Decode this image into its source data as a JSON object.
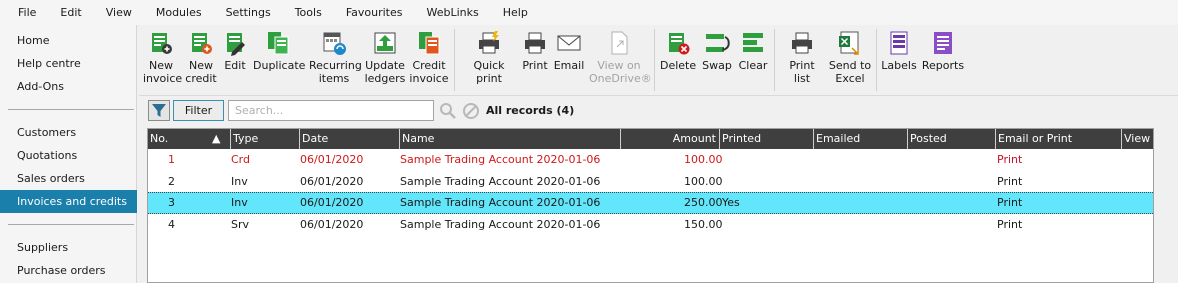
{
  "menu": [
    "File",
    "Edit",
    "View",
    "Modules",
    "Settings",
    "Tools",
    "Favourites",
    "WebLinks",
    "Help"
  ],
  "sidebar": {
    "group1": [
      "Home",
      "Help centre",
      "Add-Ons"
    ],
    "group2": [
      "Customers",
      "Quotations",
      "Sales orders",
      "Invoices and credits"
    ],
    "group3": [
      "Suppliers",
      "Purchase orders"
    ],
    "active": "Invoices and credits"
  },
  "toolbar": {
    "new_invoice": "New\ninvoice",
    "new_credit": "New\ncredit",
    "edit": "Edit",
    "duplicate": "Duplicate",
    "recurring_items": "Recurring\nitems",
    "update_ledgers": "Update\nledgers",
    "credit_invoice": "Credit\ninvoice",
    "quick_print": "Quick print",
    "print": "Print",
    "email": "Email",
    "view_onedrive": "View on\nOneDrive®",
    "delete": "Delete",
    "swap": "Swap",
    "clear": "Clear",
    "print_list": "Print list",
    "send_to_excel": "Send to\nExcel",
    "labels": "Labels",
    "reports": "Reports"
  },
  "filterbar": {
    "filter_label": "Filter",
    "search_placeholder": "Search...",
    "records_label": "All records (4)"
  },
  "grid": {
    "columns": [
      "No.",
      "Type",
      "Date",
      "Name",
      "Amount",
      "Printed",
      "Emailed",
      "Posted",
      "Email or Print",
      "View"
    ],
    "rows": [
      {
        "no": "1",
        "type": "Crd",
        "date": "06/01/2020",
        "name": "Sample Trading Account 2020-01-06",
        "amount": "100.00",
        "printed": "",
        "emailed": "",
        "posted": "",
        "email_or_print": "Print"
      },
      {
        "no": "2",
        "type": "Inv",
        "date": "06/01/2020",
        "name": "Sample Trading Account 2020-01-06",
        "amount": "100.00",
        "printed": "",
        "emailed": "",
        "posted": "",
        "email_or_print": "Print"
      },
      {
        "no": "3",
        "type": "Inv",
        "date": "06/01/2020",
        "name": "Sample Trading Account 2020-01-06",
        "amount": "250.00",
        "printed": "Yes",
        "emailed": "",
        "posted": "",
        "email_or_print": "Print"
      },
      {
        "no": "4",
        "type": "Srv",
        "date": "06/01/2020",
        "name": "Sample Trading Account 2020-01-06",
        "amount": "150.00",
        "printed": "",
        "emailed": "",
        "posted": "",
        "email_or_print": "Print"
      }
    ],
    "selected_row": 3
  },
  "colors": {
    "accent": "#1a7faa",
    "selected_row": "#62e6fb",
    "credit_text": "#d01818",
    "header_bg": "#3f3f3f"
  }
}
